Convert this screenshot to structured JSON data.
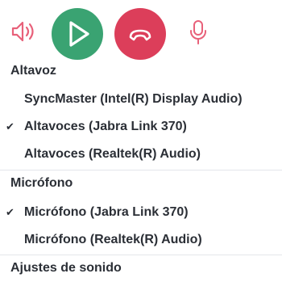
{
  "toolbar": {
    "speaker_icon": "speaker-volume-icon",
    "play_icon": "play-icon",
    "hangup_icon": "hang-up-icon",
    "mic_icon": "microphone-icon",
    "colors": {
      "green": "#3aa372",
      "red": "#dc3e5a",
      "pink_icon": "#e8617a"
    }
  },
  "speaker_section": {
    "title": "Altavoz",
    "items": [
      {
        "label": "SyncMaster (Intel(R) Display Audio)",
        "checked": false
      },
      {
        "label": "Altavoces (Jabra Link 370)",
        "checked": true
      },
      {
        "label": "Altavoces (Realtek(R) Audio)",
        "checked": false
      }
    ]
  },
  "mic_section": {
    "title": "Micrófono",
    "items": [
      {
        "label": "Micrófono (Jabra Link 370)",
        "checked": true
      },
      {
        "label": "Micrófono (Realtek(R) Audio)",
        "checked": false
      }
    ]
  },
  "footer": {
    "settings_label": "Ajustes de sonido"
  },
  "check_glyph": "✔"
}
